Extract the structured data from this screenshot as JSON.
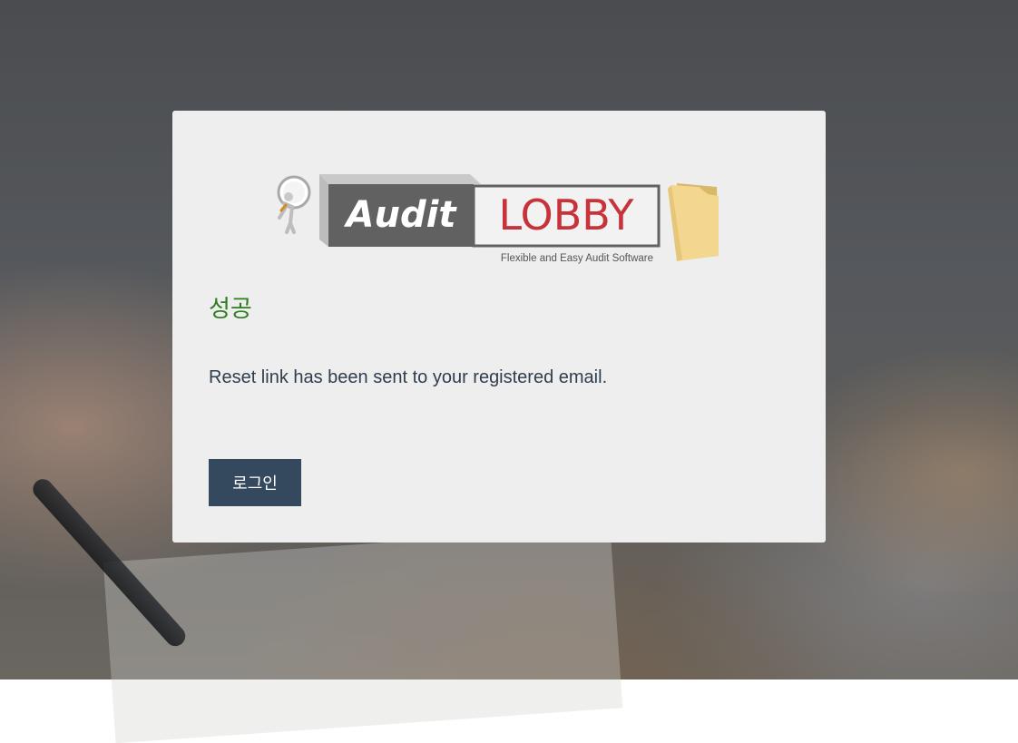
{
  "logo": {
    "word_audit": "Audit",
    "word_lobby": "LOBBY",
    "tagline": "Flexible and Easy Audit Software",
    "icons": [
      "magnifier-person-icon",
      "folder-icon"
    ]
  },
  "status": {
    "title": "성공",
    "message": "Reset link has been sent to your registered email."
  },
  "actions": {
    "login_label": "로그인"
  },
  "colors": {
    "title": "#2e7d1f",
    "button_bg": "#34495e",
    "card_bg": "#eeeeee",
    "lobby_red": "#c8323a"
  }
}
